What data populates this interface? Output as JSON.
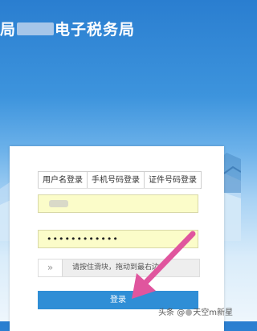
{
  "header": {
    "title_left": "局",
    "title_right": "电子税务局"
  },
  "login": {
    "tabs": [
      {
        "label": "用户名登录",
        "active": true
      },
      {
        "label": "手机号码登录",
        "active": false
      },
      {
        "label": "证件号码登录",
        "active": false
      }
    ],
    "password_value": "••••••••••••",
    "slider": {
      "handle_icon": "double-chevron-right",
      "text": "请按住滑块，拖动到最右边"
    },
    "button_label": "登录"
  },
  "watermark": {
    "prefix": "头条 @",
    "handle": "天空",
    "suffix": "m新星"
  },
  "colors": {
    "header_blue": "#2a7ed0",
    "input_yellow": "#fbfcc9",
    "button_blue": "#2f8ed6",
    "arrow_pink": "#e0559e"
  }
}
